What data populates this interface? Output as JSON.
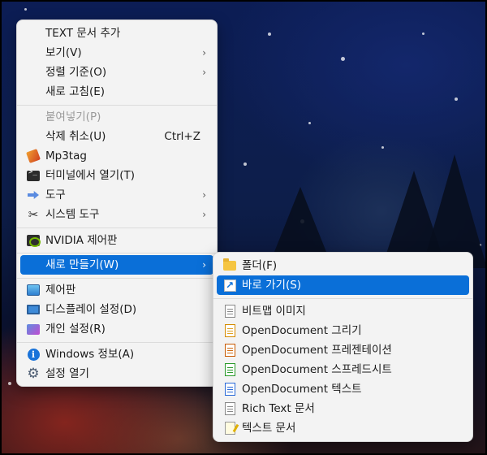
{
  "main_menu": {
    "items": [
      {
        "label": "TEXT 문서 추가",
        "icon": ""
      },
      {
        "label": "보기(V)",
        "arrow": "›"
      },
      {
        "label": "정렬 기준(O)",
        "arrow": "›"
      },
      {
        "label": "새로 고침(E)"
      },
      {
        "label": "붙여넣기(P)"
      },
      {
        "label": "삭제 취소(U)",
        "shortcut": "Ctrl+Z"
      },
      {
        "label": "Mp3tag",
        "icon": "mp3tag-icon"
      },
      {
        "label": "터미널에서 열기(T)",
        "icon": "terminal-icon"
      },
      {
        "label": "도구",
        "icon": "tool-arrow-icon",
        "arrow": "›"
      },
      {
        "label": "시스템 도구",
        "icon": "system-tools-icon",
        "arrow": "›"
      },
      {
        "label": "NVIDIA 제어판",
        "icon": "nvidia-icon"
      },
      {
        "label": "새로 만들기(W)",
        "arrow": "›"
      },
      {
        "label": "제어판",
        "icon": "control-panel-icon"
      },
      {
        "label": "디스플레이 설정(D)",
        "icon": "display-icon"
      },
      {
        "label": "개인 설정(R)",
        "icon": "personalize-icon"
      },
      {
        "label": "Windows 정보(A)",
        "icon": "info-icon",
        "icon_glyph": "i"
      },
      {
        "label": "설정 열기",
        "icon": "gear-icon",
        "icon_glyph": "⚙"
      }
    ],
    "system_tools_glyph": "✂"
  },
  "sub_menu": {
    "items": [
      {
        "label": "폴더(F)",
        "icon": "folder-icon"
      },
      {
        "label": "바로 가기(S)",
        "icon": "shortcut-icon",
        "icon_glyph": "↗"
      },
      {
        "label": "비트맵 이미지",
        "icon": "bitmap-icon"
      },
      {
        "label": "OpenDocument 그리기",
        "icon": "odg-icon"
      },
      {
        "label": "OpenDocument 프레젠테이션",
        "icon": "odp-icon"
      },
      {
        "label": "OpenDocument 스프레드시트",
        "icon": "ods-icon"
      },
      {
        "label": "OpenDocument 텍스트",
        "icon": "odt-icon"
      },
      {
        "label": "Rich Text 문서",
        "icon": "rtf-icon"
      },
      {
        "label": "텍스트 문서",
        "icon": "text-doc-icon"
      }
    ]
  },
  "colors": {
    "highlight": "#0a6fd8",
    "menu_bg": "#f3f3f3"
  }
}
